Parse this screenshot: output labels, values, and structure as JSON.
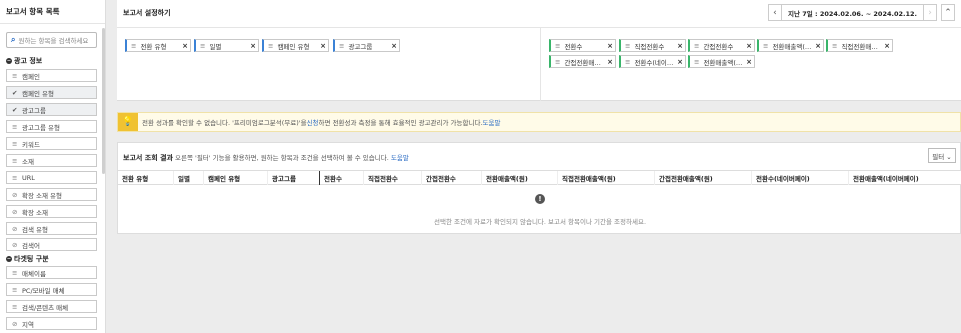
{
  "sidebar": {
    "title": "보고서 항목 목록",
    "search_placeholder": "원하는 항목을 검색하세요",
    "sections": [
      {
        "label": "광고 정보",
        "items": [
          {
            "label": "캠페인",
            "glyph": "≡",
            "selected": false
          },
          {
            "label": "캠페인 유형",
            "glyph": "✔",
            "selected": true
          },
          {
            "label": "광고그룹",
            "glyph": "✔",
            "selected": true
          },
          {
            "label": "광고그룹 유형",
            "glyph": "≡",
            "selected": false
          },
          {
            "label": "키워드",
            "glyph": "≡",
            "selected": false
          },
          {
            "label": "소재",
            "glyph": "≡",
            "selected": false
          },
          {
            "label": "URL",
            "glyph": "≡",
            "selected": false
          },
          {
            "label": "확장 소재 유형",
            "glyph": "⊘",
            "selected": false
          },
          {
            "label": "확장 소재",
            "glyph": "⊘",
            "selected": false
          },
          {
            "label": "검색 유형",
            "glyph": "⊘",
            "selected": false
          },
          {
            "label": "검색어",
            "glyph": "⊘",
            "selected": false
          }
        ]
      },
      {
        "label": "타겟팅 구분",
        "items": [
          {
            "label": "매체이름",
            "glyph": "≡",
            "selected": false
          },
          {
            "label": "PC/모바일 매체",
            "glyph": "≡",
            "selected": false
          },
          {
            "label": "검색/콘텐츠 매체",
            "glyph": "≡",
            "selected": false
          },
          {
            "label": "지역",
            "glyph": "⊘",
            "selected": false
          }
        ]
      }
    ]
  },
  "header": {
    "title": "보고서 설정하기",
    "date_range": "지난 7일 : 2024.02.06. ~ 2024.02.12.",
    "prev_icon": "‹",
    "next_icon": "›",
    "collapse_icon": "⌃"
  },
  "dimension_chips": [
    {
      "label": "전환 유형"
    },
    {
      "label": "일별"
    },
    {
      "label": "캠페인 유형"
    },
    {
      "label": "광고그룹"
    }
  ],
  "metric_chips": [
    {
      "label": "전환수"
    },
    {
      "label": "직접전환수"
    },
    {
      "label": "간접전환수"
    },
    {
      "label": "전환매출액(…"
    },
    {
      "label": "직접전환매…"
    },
    {
      "label": "간접전환매…"
    },
    {
      "label": "전환수(네이…"
    },
    {
      "label": "전환매출액(…"
    }
  ],
  "notice": {
    "text_before": "전환 성과를 확인할 수 없습니다. '프리미엄로그분석(무료)'을 ",
    "link1": "신청",
    "text_after": "하면 전환성과 측정을 통해 효율적인 광고관리가 가능합니다. ",
    "link2": "도움말"
  },
  "result": {
    "title": "보고서 조회 결과",
    "desc": " 오른쪽 '필터' 기능을 활용하면, 원하는 항목과 조건을 선택하여 볼 수 있습니다. ",
    "help": "도움말",
    "filter_label": "필터 ⌄",
    "columns": [
      "전환 유형",
      "일별",
      "캠페인 유형",
      "광고그룹",
      "전환수",
      "직접전환수",
      "간접전환수",
      "전환매출액(원)",
      "직접전환매출액(원)",
      "간접전환매출액(원)",
      "전환수(네이버페이)",
      "전환매출액(네이버페이)"
    ],
    "empty_icon": "!",
    "empty_message": "선택한 조건에 자료가 확인되지 않습니다. 보고서 항목이나 기간을 조정하세요."
  }
}
